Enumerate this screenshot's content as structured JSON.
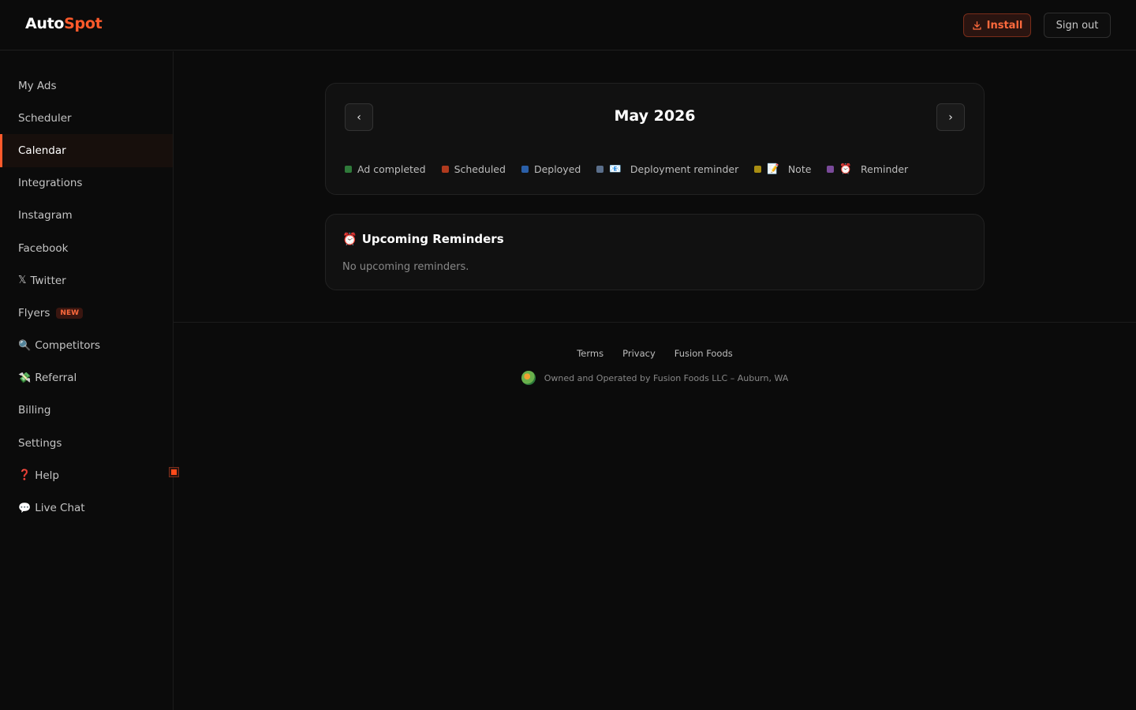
{
  "app": {
    "logo_part1": "Auto",
    "logo_part2": "Spot",
    "accent_color": "#ff5a2b"
  },
  "header": {
    "install_label": "Install",
    "install_icon": "download-icon",
    "signout_label": "Sign out"
  },
  "sidebar": {
    "items": [
      {
        "label": "My Ads",
        "icon": ""
      },
      {
        "label": "Scheduler",
        "icon": ""
      },
      {
        "label": "Calendar",
        "icon": "",
        "active": true
      },
      {
        "label": "Integrations",
        "icon": ""
      },
      {
        "label": "Instagram",
        "icon": ""
      },
      {
        "label": "Facebook",
        "icon": ""
      },
      {
        "label": "Twitter",
        "icon": "𝕏"
      },
      {
        "label": "Flyers",
        "icon": "",
        "badge": "NEW"
      },
      {
        "label": "Competitors",
        "icon": "🔍"
      },
      {
        "label": "Referral",
        "icon": "💸"
      },
      {
        "label": "Billing",
        "icon": ""
      },
      {
        "label": "Settings",
        "icon": ""
      },
      {
        "label": "Help",
        "icon": "❓"
      },
      {
        "label": "Live Chat",
        "icon": "💬"
      }
    ]
  },
  "calendar": {
    "month_label": "May 2026",
    "prev_label": "‹",
    "next_label": "›",
    "legend": [
      {
        "label": "Ad completed",
        "color": "#2f7a3a",
        "icon": ""
      },
      {
        "label": "Scheduled",
        "color": "#b03a1e",
        "icon": ""
      },
      {
        "label": "Deployed",
        "color": "#2a5fa8",
        "icon": ""
      },
      {
        "label": "Deployment reminder",
        "color": "#5a6e8a",
        "icon": "📧"
      },
      {
        "label": "Note",
        "color": "#a88d12",
        "icon": "📝"
      },
      {
        "label": "Reminder",
        "color": "#7a4a9a",
        "icon": "⏰"
      }
    ]
  },
  "reminders": {
    "icon": "⏰",
    "title": "Upcoming Reminders",
    "empty_text": "No upcoming reminders."
  },
  "footer": {
    "links": [
      "Terms",
      "Privacy",
      "Fusion Foods"
    ],
    "owner_text": "Owned and Operated by Fusion Foods LLC – Auburn, WA"
  }
}
